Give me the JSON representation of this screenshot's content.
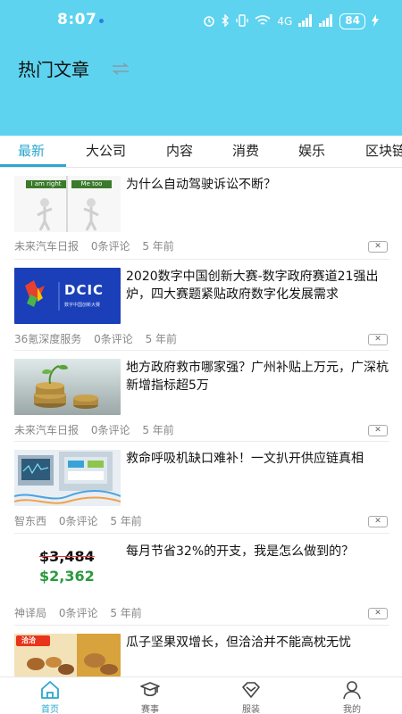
{
  "status_bar": {
    "time": "8:07",
    "signal_label": "4G",
    "battery": "84"
  },
  "header": {
    "title": "热门文章"
  },
  "tabs": [
    {
      "label": "最新",
      "active": true
    },
    {
      "label": "大公司",
      "active": false
    },
    {
      "label": "内容",
      "active": false
    },
    {
      "label": "消费",
      "active": false
    },
    {
      "label": "娱乐",
      "active": false
    },
    {
      "label": "区块链",
      "active": false
    }
  ],
  "articles": [
    {
      "title": "为什么自动驾驶诉讼不断？",
      "source": "未来汽车日报",
      "comments": "0条评论",
      "time": "5 年前",
      "thumb_text": [
        "I am right",
        "Me too"
      ]
    },
    {
      "title": "2020数字中国创新大赛-数字政府赛道21强出炉，四大赛题紧贴政府数字化发展需求",
      "source": "36氪深度服务",
      "comments": "0条评论",
      "time": "5 年前",
      "thumb_text": [
        "DCIC",
        "数字中国创新大赛"
      ]
    },
    {
      "title": "地方政府救市哪家强？广州补贴上万元，广深杭新增指标超5万",
      "source": "未来汽车日报",
      "comments": "0条评论",
      "time": "5 年前"
    },
    {
      "title": "救命呼吸机缺口难补！一文扒开供应链真相",
      "source": "智东西",
      "comments": "0条评论",
      "time": "5 年前"
    },
    {
      "title": "每月节省32%的开支，我是怎么做到的？",
      "source": "神译局",
      "comments": "0条评论",
      "time": "5 年前",
      "thumb_text": [
        "$3,484",
        "$2,362"
      ]
    },
    {
      "title": "瓜子坚果双增长，但洽洽并不能高枕无忧",
      "thumb_text": [
        "洽洽"
      ]
    }
  ],
  "close_glyph": "✕",
  "bottom_nav": [
    {
      "label": "首页",
      "icon": "home-icon",
      "active": true
    },
    {
      "label": "赛事",
      "icon": "mortarboard-icon",
      "active": false
    },
    {
      "label": "服装",
      "icon": "diamond-icon",
      "active": false
    },
    {
      "label": "我的",
      "icon": "person-icon",
      "active": false
    }
  ],
  "colors": {
    "header_bg": "#5dd3ef",
    "accent": "#2ba7cf"
  }
}
